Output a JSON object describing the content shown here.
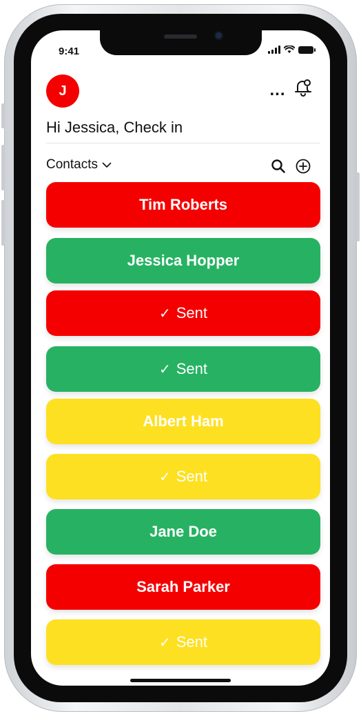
{
  "status_bar": {
    "time": "9:41"
  },
  "header": {
    "avatar_initial": "J",
    "greeting": "Hi Jessica, Check in",
    "more_label": "..."
  },
  "toolbar": {
    "contacts_label": "Contacts"
  },
  "colors": {
    "red": "#f40000",
    "green": "#27b263",
    "yellow": "#fde021"
  },
  "cards": [
    {
      "label": "Tim Roberts",
      "color": "red",
      "sent": false
    },
    {
      "label": "Jessica Hopper",
      "color": "green",
      "sent": false
    },
    {
      "label": "Sent",
      "color": "red",
      "sent": true
    },
    {
      "label": "Sent",
      "color": "green",
      "sent": true
    },
    {
      "label": "Albert Ham",
      "color": "yellow",
      "sent": false
    },
    {
      "label": "Sent",
      "color": "yellow",
      "sent": true
    },
    {
      "label": "Jane Doe",
      "color": "green",
      "sent": false
    },
    {
      "label": "Sarah Parker",
      "color": "red",
      "sent": false
    },
    {
      "label": "Sent",
      "color": "yellow",
      "sent": true
    }
  ]
}
